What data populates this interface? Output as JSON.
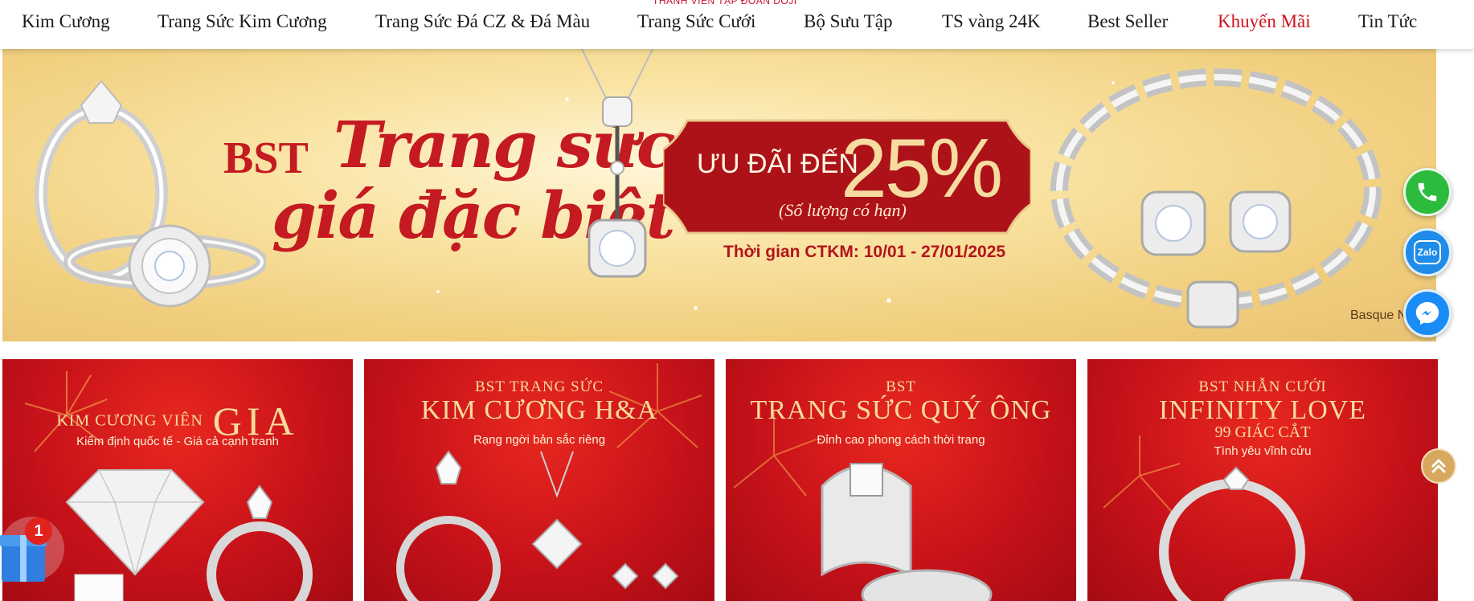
{
  "nav": {
    "tagline": "THÀNH VIÊN TẬP ĐOÀN DOJI",
    "items": [
      {
        "label": "Kim Cương"
      },
      {
        "label": "Trang Sức Kim Cương"
      },
      {
        "label": "Trang Sức Đá CZ & Đá Màu"
      },
      {
        "label": "Trang Sức Cưới"
      },
      {
        "label": "Bộ Sưu Tập"
      },
      {
        "label": "TS vàng 24K"
      },
      {
        "label": "Best Seller"
      },
      {
        "label": "Khuyến Mãi"
      },
      {
        "label": "Tin Tức"
      }
    ],
    "promo_color": "#d0121f"
  },
  "hero": {
    "bst": "BST",
    "script_line1": "Trang sức",
    "script_line2": "giá đặc biệt",
    "promo_lead": "ƯU ĐÃI ĐẾN",
    "promo_pct": "25%",
    "promo_note": "(Số lượng có hạn)",
    "promo_period": "Thời gian CTKM: 10/01 - 27/01/2025",
    "credit": "Basque N"
  },
  "cards": [
    {
      "line1": "KIM CƯƠNG VIÊN",
      "big": "GIA",
      "sub": "Kiểm định quốc tế - Giá cả cạnh tranh",
      "extra": ""
    },
    {
      "line1": "BST TRANG SỨC",
      "big": "KIM CƯƠNG H&A",
      "sub": "Rạng ngời bản sắc riêng",
      "extra": ""
    },
    {
      "line1": "BST",
      "big": "TRANG SỨC QUÝ ÔNG",
      "sub": "Đỉnh cao phong cách thời trang",
      "extra": ""
    },
    {
      "line1": "BST NHẪN CƯỚI",
      "big": "INFINITY LOVE",
      "sub": "Tình yêu vĩnh cửu",
      "extra": "99 GIÁC CẮT"
    }
  ],
  "floating": {
    "zalo_label": "Zalo",
    "gift_count": "1"
  },
  "colors": {
    "brand_red": "#c41a21",
    "gold": "#f7dc9b",
    "phone_green": "#2dbb3e",
    "messenger_blue": "#1a8cf5"
  },
  "icons": [
    "phone-icon",
    "zalo-icon",
    "messenger-icon",
    "chevron-up-icon",
    "gift-icon"
  ]
}
